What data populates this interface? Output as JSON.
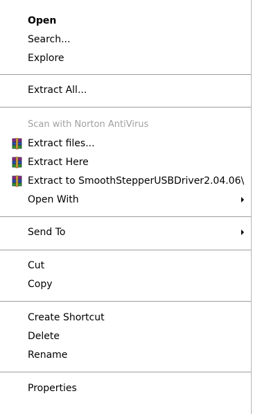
{
  "menu": {
    "open": "Open",
    "search": "Search...",
    "explore": "Explore",
    "extract_all": "Extract All...",
    "scan_norton": "Scan with Norton AntiVirus",
    "extract_files": "Extract files...",
    "extract_here": "Extract Here",
    "extract_to": "Extract to SmoothStepperUSBDriver2.04.06\\",
    "open_with": "Open With",
    "send_to": "Send To",
    "cut": "Cut",
    "copy": "Copy",
    "create_shortcut": "Create Shortcut",
    "delete": "Delete",
    "rename": "Rename",
    "properties": "Properties"
  },
  "icons": {
    "archive": "winrar-archive-icon",
    "submenu": "submenu-arrow-icon"
  },
  "colors": {
    "background": "#ffffff",
    "text": "#000000",
    "disabled_text": "#a0a0a0",
    "separator": "#9c9c9c"
  }
}
